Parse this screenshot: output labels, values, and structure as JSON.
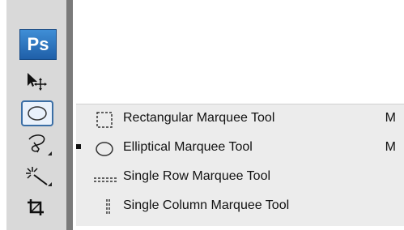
{
  "app": {
    "logo_text": "Ps"
  },
  "tools": [
    {
      "name": "move-tool",
      "icon": "move-icon"
    },
    {
      "name": "marquee-tool",
      "icon": "ellipse-marquee-icon",
      "active": true
    },
    {
      "name": "lasso-tool",
      "icon": "lasso-icon"
    },
    {
      "name": "magic-wand-tool",
      "icon": "magic-wand-icon"
    },
    {
      "name": "crop-tool",
      "icon": "crop-icon"
    }
  ],
  "flyout": {
    "items": [
      {
        "label": "Rectangular Marquee Tool",
        "shortcut": "M",
        "selected": false,
        "icon": "rect-marquee-icon"
      },
      {
        "label": "Elliptical Marquee Tool",
        "shortcut": "M",
        "selected": true,
        "icon": "ellipse-marquee-icon"
      },
      {
        "label": "Single Row Marquee Tool",
        "shortcut": "",
        "selected": false,
        "icon": "single-row-marquee-icon"
      },
      {
        "label": "Single Column Marquee Tool",
        "shortcut": "",
        "selected": false,
        "icon": "single-column-marquee-icon"
      }
    ]
  },
  "colors": {
    "panel_bg": "#d9d9d9",
    "flyout_bg": "#ececec",
    "logo_blue": "#2b72c3",
    "active_border": "#3a6ea5"
  }
}
